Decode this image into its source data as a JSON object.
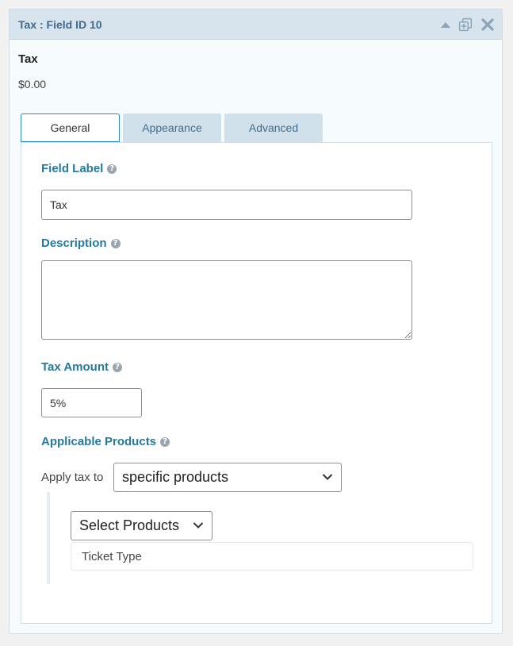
{
  "header": {
    "title": "Tax : Field ID 10",
    "icons": [
      "collapse-arrow-icon",
      "duplicate-icon",
      "close-icon"
    ]
  },
  "preview": {
    "name": "Tax",
    "price": "$0.00"
  },
  "tabs": [
    {
      "label": "General",
      "active": true
    },
    {
      "label": "Appearance",
      "active": false
    },
    {
      "label": "Advanced",
      "active": false
    }
  ],
  "general": {
    "field_label": {
      "label": "Field Label",
      "value": "Tax"
    },
    "description": {
      "label": "Description",
      "value": ""
    },
    "tax_amount": {
      "label": "Tax Amount",
      "value": "5%"
    },
    "applicable_products": {
      "label": "Applicable Products",
      "apply_text": "Apply tax to",
      "apply_value": "specific products",
      "select_placeholder": "Select Products",
      "selected_products": [
        "Ticket Type"
      ]
    }
  },
  "help_glyph": "?",
  "colors": {
    "header_bg": "#d7e4ee",
    "title": "#3e6b8c",
    "label": "#24799f",
    "tab_active_border": "#2e87c0",
    "tab_inactive_bg": "#d1e1ec"
  }
}
